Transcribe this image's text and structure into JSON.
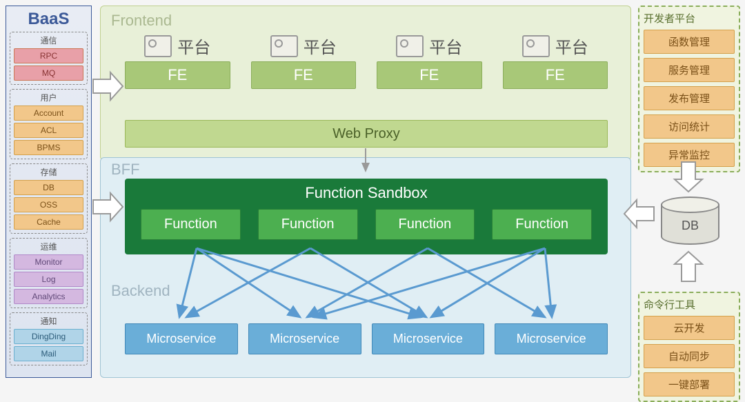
{
  "baas": {
    "title": "BaaS",
    "groups": [
      {
        "title": "通信",
        "cls": "p-red",
        "items": [
          "RPC",
          "MQ"
        ]
      },
      {
        "title": "用户",
        "cls": "p-orange",
        "items": [
          "Account",
          "ACL",
          "BPMS"
        ]
      },
      {
        "title": "存储",
        "cls": "p-orange",
        "items": [
          "DB",
          "OSS",
          "Cache"
        ]
      },
      {
        "title": "运维",
        "cls": "p-purple",
        "items": [
          "Monitor",
          "Log",
          "Analytics"
        ]
      },
      {
        "title": "通知",
        "cls": "p-lblue",
        "items": [
          "DingDing",
          "Mail"
        ]
      }
    ]
  },
  "frontend": {
    "label": "Frontend",
    "platform_label": "平台",
    "fe_label": "FE",
    "count": 4,
    "proxy": "Web Proxy"
  },
  "bff": {
    "label": "BFF",
    "sandbox_title": "Function Sandbox",
    "fn_label": "Function",
    "fn_count": 4
  },
  "backend": {
    "label": "Backend",
    "ms_label": "Microservice",
    "ms_count": 4
  },
  "devplat": {
    "title": "开发者平台",
    "items": [
      "函数管理",
      "服务管理",
      "发布管理",
      "访问统计",
      "异常监控"
    ]
  },
  "db": {
    "label": "DB"
  },
  "cli": {
    "title": "命令行工具",
    "items": [
      "云开发",
      "自动同步",
      "一键部署"
    ]
  }
}
